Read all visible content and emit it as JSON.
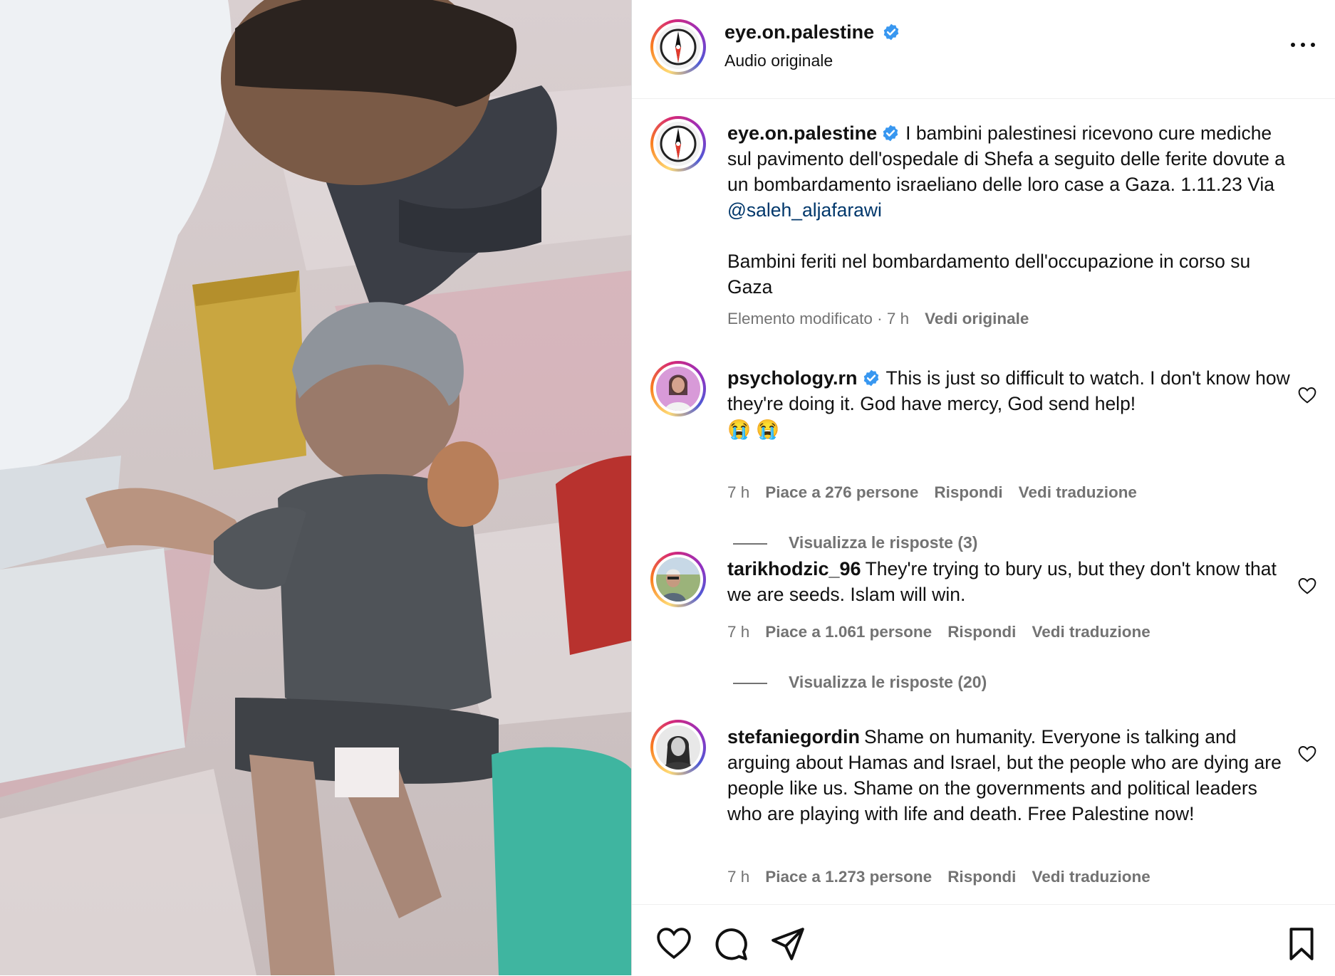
{
  "post": {
    "username": "eye.on.palestine",
    "subtitle": "Audio originale",
    "verified": true
  },
  "caption": {
    "username": "eye.on.palestine",
    "text_before_mention": "I bambini palestinesi ricevono cure mediche sul pavimento dell'ospedale di Shefa a seguito delle ferite dovute a un bombardamento israeliano delle loro case a Gaza. 1.11.23 Via ",
    "mention": "@saleh_aljafarawi",
    "text_second": "Bambini feriti nel bombardamento dell'occupazione in corso su Gaza",
    "edited_label": "Elemento modificato · 7 h",
    "see_original": "Vedi originale"
  },
  "comments": [
    {
      "username": "psychology.rn",
      "verified": true,
      "text": "This is just so difficult to watch. I don't know how they're doing it. God have mercy, God send help!",
      "emoji": "😭 😭",
      "time": "7 h",
      "likes": "Piace a 276 persone",
      "reply": "Rispondi",
      "translate": "Vedi traduzione",
      "view_replies": "Visualizza le risposte (3)"
    },
    {
      "username": "tarikhodzic_96",
      "verified": false,
      "text": "They're trying to bury us, but they don't know that we are seeds. Islam will win.",
      "time": "7 h",
      "likes": "Piace a 1.061 persone",
      "reply": "Rispondi",
      "translate": "Vedi traduzione",
      "view_replies": "Visualizza le risposte (20)"
    },
    {
      "username": "stefaniegordin",
      "verified": false,
      "text": "Shame on humanity. Everyone is talking and arguing about Hamas and Israel, but the people who are dying are people like us. Shame on the governments and political leaders who are playing with life and death. Free Palestine now!",
      "time": "7 h",
      "likes": "Piace a 1.273 persone",
      "reply": "Rispondi",
      "translate": "Vedi traduzione"
    }
  ],
  "actions": {
    "like_icon": "heart-icon",
    "comment_icon": "comment-icon",
    "share_icon": "paper-plane-icon",
    "save_icon": "bookmark-icon"
  },
  "colors": {
    "verified_blue": "#3897f0",
    "secondary_text": "#737373",
    "mention": "#00376b"
  }
}
